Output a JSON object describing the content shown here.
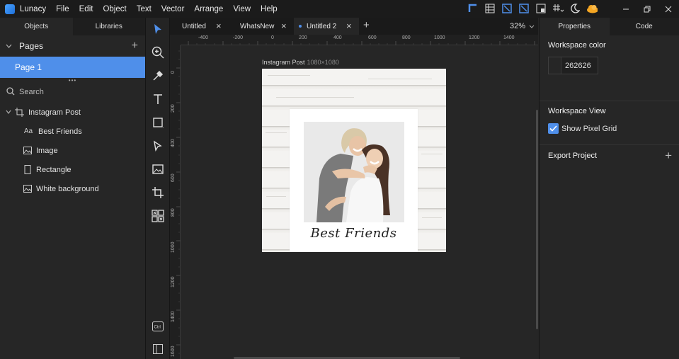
{
  "app": {
    "name": "Lunacy"
  },
  "menu": [
    "File",
    "Edit",
    "Object",
    "Text",
    "Vector",
    "Arrange",
    "View",
    "Help"
  ],
  "colors": {
    "accent": "#4f8fea",
    "workspace": "#262626"
  },
  "left_panel": {
    "tabs": [
      "Objects",
      "Libraries"
    ],
    "pages_title": "Pages",
    "pages": [
      "Page 1"
    ],
    "search_label": "Search",
    "layers": {
      "root": "Instagram Post",
      "children": [
        {
          "icon": "text-layer-icon",
          "label": "Best Friends"
        },
        {
          "icon": "image-layer-icon",
          "label": "Image"
        },
        {
          "icon": "rectangle-layer-icon",
          "label": "Rectangle"
        },
        {
          "icon": "image-layer-icon",
          "label": "White background"
        }
      ]
    }
  },
  "doc_tabs": [
    "Untitled",
    "WhatsNew",
    "Untitled 2"
  ],
  "zoom": "32%",
  "ruler": {
    "x_labels": [
      "-400",
      "-200",
      "0",
      "200",
      "400",
      "600",
      "800",
      "1000",
      "1200",
      "1400"
    ],
    "y_labels": [
      "0",
      "200",
      "400",
      "600",
      "800",
      "1000",
      "1200",
      "1400",
      "1600"
    ]
  },
  "artboard": {
    "title": "Instagram Post",
    "size": "1080×1080",
    "caption": "Best Friends"
  },
  "right_panel": {
    "tabs": [
      "Properties",
      "Code"
    ],
    "workspace_color_title": "Workspace color",
    "workspace_color_value": "262626",
    "workspace_view_title": "Workspace View",
    "show_pixel_grid_label": "Show Pixel Grid",
    "show_pixel_grid_checked": true,
    "export_title": "Export Project"
  }
}
